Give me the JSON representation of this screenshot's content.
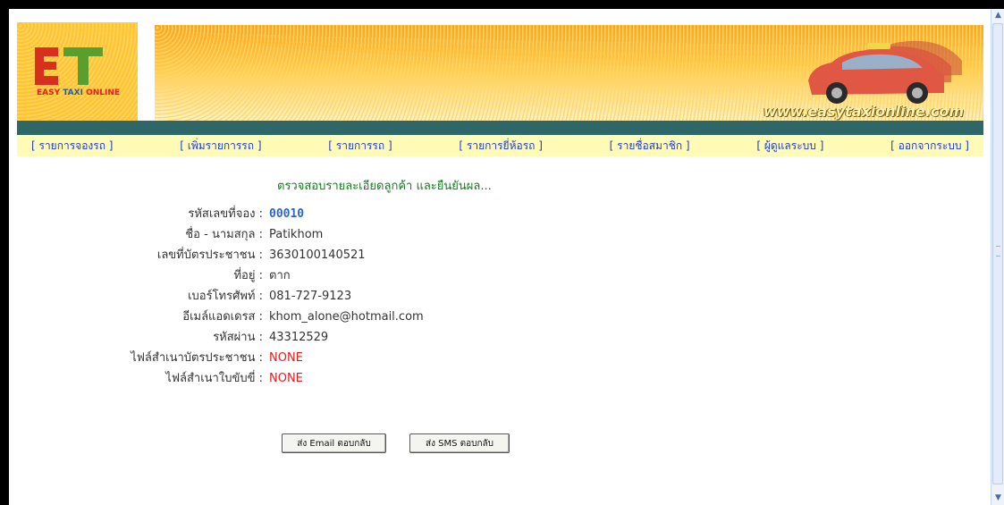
{
  "banner": {
    "logo_text_prefix": "EASY",
    "logo_text_taxi": "TAXI",
    "logo_text_suffix": "ONLINE",
    "url": "www.easytaxionline.com"
  },
  "nav": {
    "items": [
      "[ รายการจองรถ ]",
      "[ เพิ่มรายการรถ ]",
      "[ รายการรถ ]",
      "[ รายการยี่ห้อรถ ]",
      "[ รายชื่อสมาชิก ]",
      "[ ผู้ดูแลระบบ ]",
      "[ ออกจากระบบ ]"
    ]
  },
  "verify": {
    "title": "ตรวจสอบรายละเอียดลูกค้า และยืนยันผล...",
    "fields": [
      {
        "label": "รหัสเลขที่จอง :",
        "value": "00010"
      },
      {
        "label": "ชื่อ - นามสกุล :",
        "value": "Patikhom"
      },
      {
        "label": "เลขที่บัตรประชาชน :",
        "value": "3630100140521"
      },
      {
        "label": "ที่อยู่ :",
        "value": "ตาก"
      },
      {
        "label": "เบอร์โทรศัพท์ :",
        "value": "081-727-9123"
      },
      {
        "label": "อีเมล์แอดเดรส :",
        "value": "khom_alone@hotmail.com"
      },
      {
        "label": "รหัสผ่าน :",
        "value": "43312529"
      },
      {
        "label": "ไฟล์สำเนาบัตรประชาชน :",
        "value": "NONE"
      },
      {
        "label": "ไฟล์สำเนาใบขับขี่ :",
        "value": "NONE"
      }
    ]
  },
  "actions": {
    "email_label": "ส่ง Email ตอบกลับ",
    "sms_label": "ส่ง SMS ตอบกลับ"
  },
  "colors": {
    "nav_bar": "#fffbb6",
    "nav_dark": "#2f6668",
    "title_green": "#0e7f17",
    "code_blue": "#2e63c7",
    "none_red": "#e01e1e"
  }
}
